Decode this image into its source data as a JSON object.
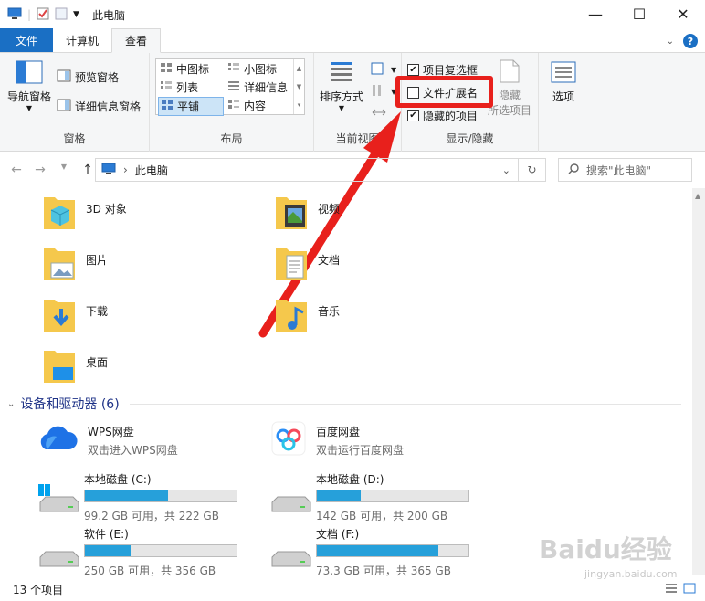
{
  "window": {
    "title": "此电脑",
    "controls": [
      "—",
      "☐",
      "✕"
    ]
  },
  "tabs": [
    {
      "label": "文件"
    },
    {
      "label": "计算机"
    },
    {
      "label": "查看"
    }
  ],
  "ribbon": {
    "pane_group": {
      "label": "窗格",
      "nav_pane": "导航窗格",
      "preview_pane": "预览窗格",
      "details_pane": "详细信息窗格"
    },
    "layout_group": {
      "label": "布局",
      "items": [
        "中图标",
        "小图标",
        "列表",
        "详细信息",
        "平铺",
        "内容"
      ]
    },
    "view_group": {
      "label": "当前视图",
      "sort_by": "排序方式"
    },
    "show_hide_group": {
      "label": "显示/隐藏",
      "item_checkboxes": "项目复选框",
      "file_extensions": "文件扩展名",
      "hidden_items": "隐藏的项目",
      "hide_selected": "隐藏",
      "hide_selected_2": "所选项目"
    },
    "options": "选项"
  },
  "address": {
    "path": "此电脑",
    "search_placeholder": "搜索\"此电脑\""
  },
  "folders": [
    {
      "name": "3D 对象"
    },
    {
      "name": "视频"
    },
    {
      "name": "图片"
    },
    {
      "name": "文档"
    },
    {
      "name": "下载"
    },
    {
      "name": "音乐"
    },
    {
      "name": "桌面"
    }
  ],
  "devices_header": "设备和驱动器 (6)",
  "cloud": [
    {
      "name": "WPS网盘",
      "desc": "双击进入WPS网盘"
    },
    {
      "name": "百度网盘",
      "desc": "双击运行百度网盘"
    }
  ],
  "drives": [
    {
      "name": "本地磁盘 (C:)",
      "free": "99.2 GB 可用，共 222 GB",
      "used_fraction": 0.55
    },
    {
      "name": "本地磁盘 (D:)",
      "free": "142 GB 可用，共 200 GB",
      "used_fraction": 0.29
    },
    {
      "name": "软件 (E:)",
      "free": "250 GB 可用，共 356 GB",
      "used_fraction": 0.3
    },
    {
      "name": "文档 (F:)",
      "free": "73.3 GB 可用，共 365 GB",
      "used_fraction": 0.8
    }
  ],
  "status": {
    "count": "13 个项目"
  },
  "watermark": {
    "text": "Baidu经验",
    "url": "jingyan.baidu.com"
  },
  "colors": {
    "accent": "#1a6fc4",
    "drive_fill": "#26a0da",
    "highlight": "#e8201c"
  }
}
